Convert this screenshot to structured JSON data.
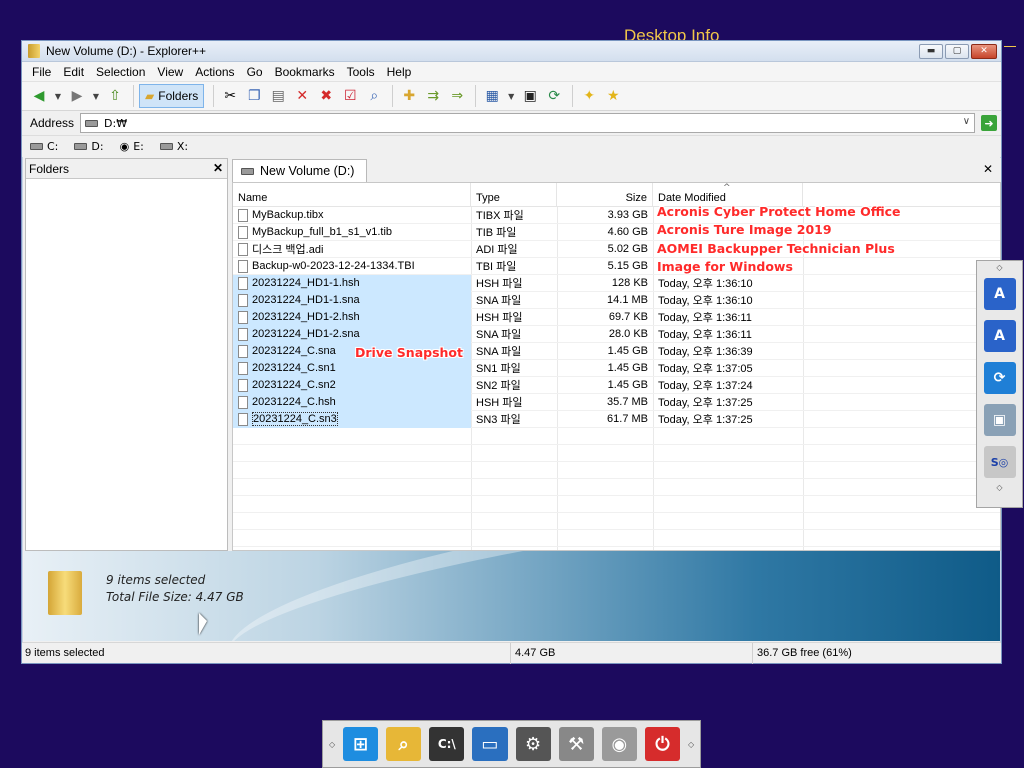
{
  "desktop": {
    "info_text": "Desktop Info"
  },
  "window": {
    "title": "New Volume (D:) - Explorer++"
  },
  "menu": [
    "File",
    "Edit",
    "Selection",
    "View",
    "Actions",
    "Go",
    "Bookmarks",
    "Tools",
    "Help"
  ],
  "toolbar": {
    "folders_label": "Folders"
  },
  "address": {
    "label": "Address",
    "value": "D:₩"
  },
  "drives": [
    "C:",
    "D:",
    "E:",
    "X:"
  ],
  "folders_pane": {
    "title": "Folders"
  },
  "tab": {
    "label": "New Volume (D:)"
  },
  "columns": {
    "name": "Name",
    "type": "Type",
    "size": "Size",
    "date": "Date Modified"
  },
  "files": [
    {
      "name": "MyBackup.tibx",
      "type": "TIBX 파일",
      "size": "3.93 GB",
      "date": ""
    },
    {
      "name": "MyBackup_full_b1_s1_v1.tib",
      "type": "TIB 파일",
      "size": "4.60 GB",
      "date": ""
    },
    {
      "name": "디스크 백업.adi",
      "type": "ADI 파일",
      "size": "5.02 GB",
      "date": ""
    },
    {
      "name": "Backup-w0-2023-12-24-1334.TBI",
      "type": "TBI 파일",
      "size": "5.15 GB",
      "date": ""
    },
    {
      "name": "20231224_HD1-1.hsh",
      "type": "HSH 파일",
      "size": "128 KB",
      "date": "Today, 오후 1:36:10"
    },
    {
      "name": "20231224_HD1-1.sna",
      "type": "SNA 파일",
      "size": "14.1 MB",
      "date": "Today, 오후 1:36:10"
    },
    {
      "name": "20231224_HD1-2.hsh",
      "type": "HSH 파일",
      "size": "69.7 KB",
      "date": "Today, 오후 1:36:11"
    },
    {
      "name": "20231224_HD1-2.sna",
      "type": "SNA 파일",
      "size": "28.0 KB",
      "date": "Today, 오후 1:36:11"
    },
    {
      "name": "20231224_C.sna",
      "type": "SNA 파일",
      "size": "1.45 GB",
      "date": "Today, 오후 1:36:39"
    },
    {
      "name": "20231224_C.sn1",
      "type": "SN1 파일",
      "size": "1.45 GB",
      "date": "Today, 오후 1:37:05"
    },
    {
      "name": "20231224_C.sn2",
      "type": "SN2 파일",
      "size": "1.45 GB",
      "date": "Today, 오후 1:37:24"
    },
    {
      "name": "20231224_C.hsh",
      "type": "HSH 파일",
      "size": "35.7 MB",
      "date": "Today, 오후 1:37:25"
    },
    {
      "name": "20231224_C.sn3",
      "type": "SN3 파일",
      "size": "61.7 MB",
      "date": "Today, 오후 1:37:25"
    }
  ],
  "annotations": {
    "acronis_cyber": "Acronis Cyber Protect Home Office",
    "acronis_true": "Acronis Ture Image 2019",
    "aomei": "AOMEI Backupper Technician Plus",
    "image_windows": "Image for Windows",
    "drive_snapshot": "Drive Snapshot"
  },
  "info_panel": {
    "line1": "9 items selected",
    "line2": "Total File Size: 4.47 GB"
  },
  "status": {
    "items": "9 items selected",
    "size": "4.47 GB",
    "free": "36.7 GB free (61%)"
  },
  "colors": {
    "desktop_bg": "#1c0a5e",
    "selection": "#cce8ff",
    "annotation": "#ff2a2a",
    "desktop_info": "#f0c64a"
  }
}
